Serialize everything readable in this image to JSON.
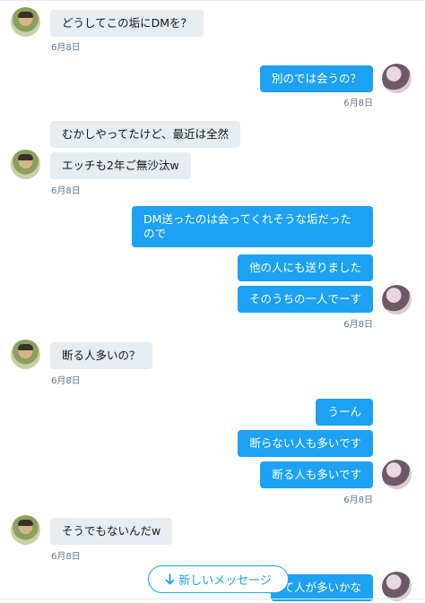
{
  "conversation": {
    "messages": [
      {
        "side": "in",
        "text": "どうしてこの垢にDMを？"
      },
      {
        "side": "out",
        "text": "別のでは会うの？"
      },
      {
        "side": "in",
        "text": "むかしやってたけど、最近は全然"
      },
      {
        "side": "in",
        "text": "エッチも2年ご無沙汰w"
      },
      {
        "side": "out",
        "text": "DM送ったのは会ってくれそうな垢だったので"
      },
      {
        "side": "out",
        "text": "他の人にも送りました"
      },
      {
        "side": "out",
        "text": "そのうちの一人でーす"
      },
      {
        "side": "in",
        "text": "断る人多いの？"
      },
      {
        "side": "out",
        "text": "うーん"
      },
      {
        "side": "out",
        "text": "断らない人も多いです"
      },
      {
        "side": "out",
        "text": "断る人も多いです"
      },
      {
        "side": "in",
        "text": "そうでもないんだw"
      },
      {
        "side": "out",
        "text": "て人が多いかな"
      }
    ],
    "timestamps": [
      "6月8日",
      "6月8日",
      "6月8日",
      "6月8日",
      "6月8日",
      "6月8日",
      "6月8日",
      "6月8日",
      "6月8日"
    ]
  },
  "new_messages_button": {
    "label": "新しいメッセージ",
    "icon": "arrow-down-icon"
  },
  "colors": {
    "outgoing_bubble": "#1da1f2",
    "incoming_bubble": "#e6ecf0",
    "timestamp": "#657786"
  }
}
